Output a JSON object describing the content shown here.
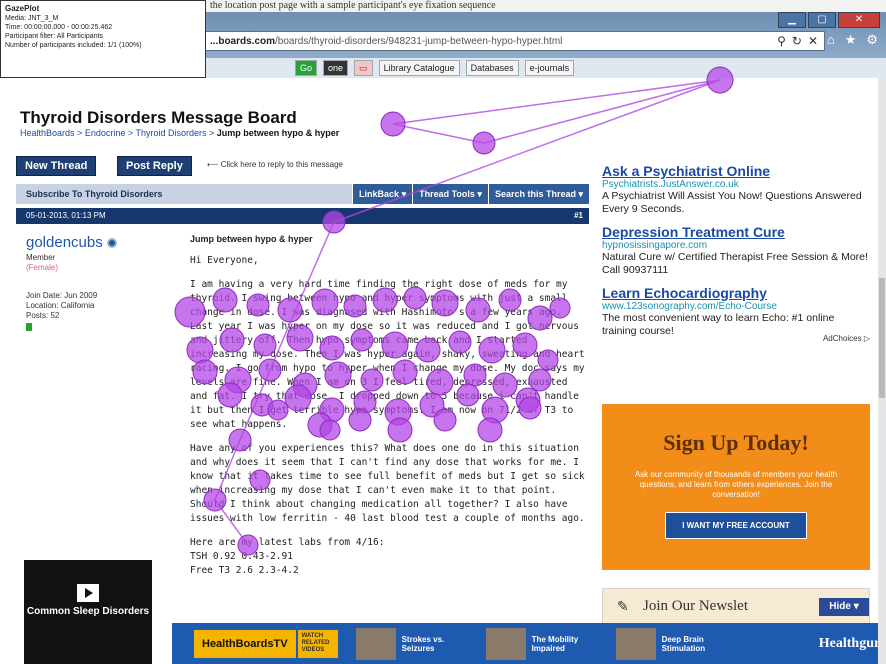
{
  "top_strip_text": "the location post page with a sample participant's eye fixation sequence",
  "gaze_info": {
    "title": "GazePlot",
    "lines": [
      "Media: JNT_3_M",
      "Time: 00:00:00.000 - 00:00:25.462",
      "Participant filter: All Participants",
      "Number of participants included: 1/1 (100%)"
    ]
  },
  "browser": {
    "url_prefix": "...boards.com",
    "url_rest": "/boards/thyroid-disorders/948231-jump-between-hypo-hyper.html",
    "favorites": [
      "Go",
      "one",
      "Library Catalogue",
      "Databases",
      "e-journals"
    ]
  },
  "page": {
    "board_title": "Thyroid Disorders Message Board",
    "breadcrumb": [
      "HealthBoards",
      "Endocrine",
      "Thyroid Disorders"
    ],
    "breadcrumb_current": "Jump between hypo & hyper",
    "new_thread": "New Thread",
    "post_reply": "Post Reply",
    "reply_hint": "Click here to reply to this message",
    "subscribe": "Subscribe To Thyroid Disorders",
    "menus": [
      "LinkBack ▾",
      "Thread Tools ▾",
      "Search this Thread ▾"
    ],
    "post_date": "05-01-2013, 01:13 PM",
    "post_num": "#1"
  },
  "user": {
    "name": "goldencubs",
    "role": "Member",
    "gender": "(Female)",
    "join": "Join Date: Jun 2009",
    "location": "Location: California",
    "posts": "Posts: 52"
  },
  "post": {
    "title": "Jump between hypo & hyper",
    "greeting": "Hi Everyone,",
    "para1": "I am having a very hard time finding the right dose of meds for my thyroid. I swing between hypo and hyper symptoms with just a small change in dose. I was diagnosed with Hashimoto's a few years ago. Last year I was hyper on my dose so it was reduced and I got nervous and jittery off. Then hypo symptoms came back and I started increasing my dose. Then I was hyper again, shaky, sweating and heart racing. I go from hypo to hyper when I change my dose. My doc says my levels are fine. When I am on 3 I feel tired, depressed, exhausted and fat. I try that dose. I dropped down to 5 because i can't handle it but then I get terrible hypo symptoms. I am now on 71/2 of T3 to see what happens.",
    "para2": "Have any of you experiences this? What does one do in this situation and why does it seem that I can't find any dose that works for me. I know that it takes time to see full benefit of meds but I get so sick when increasing my dose that I can't even make it to that point. Should I think about changing medication all together? I also have issues with low ferritin - 40 last blood test a couple of months ago.",
    "para3": "Here are my latest labs from 4/16:",
    "lab1": "TSH 0.92 0.43-2.91",
    "lab2": "Free T3 2.6 2.3-4.2"
  },
  "ads": [
    {
      "title": "Ask a Psychiatrist Online",
      "url": "Psychiatrists.JustAnswer.co.uk",
      "body": "A Psychiatrist Will Assist You Now! Questions Answered Every 9 Seconds."
    },
    {
      "title": "Depression Treatment Cure",
      "url": "hypnosissingapore.com",
      "body": "Natural Cure w/ Certified Therapist Free Session & More! Call 90937111"
    },
    {
      "title": "Learn Echocardiography",
      "url": "www.123sonography.com/Echo-Course",
      "body": "The most convenient way to learn Echo: #1 online training course!"
    }
  ],
  "adchoices": "AdChoices ▷",
  "signup": {
    "heading": "Sign Up Today!",
    "text": "Ask our community of thousands of members your health questions, and learn from others experiences. Join the conversation!",
    "cta": "I WANT MY FREE ACCOUNT"
  },
  "newsletter": "Join Our Newslet",
  "hide": "Hide ▾",
  "sleep_video": "Common Sleep Disorders",
  "bottom": {
    "brand": "HealthBoardsTV",
    "watch": "WATCH RELATED VIDEOS",
    "videos": [
      "Strokes vs. Seizures",
      "The Mobility Impaired",
      "Deep Brain Stimulation"
    ],
    "partner": "Healthguru"
  },
  "colors": {
    "gaze": "#b347e6",
    "header_blue": "#16376d",
    "signup_orange": "#f28d1a"
  }
}
